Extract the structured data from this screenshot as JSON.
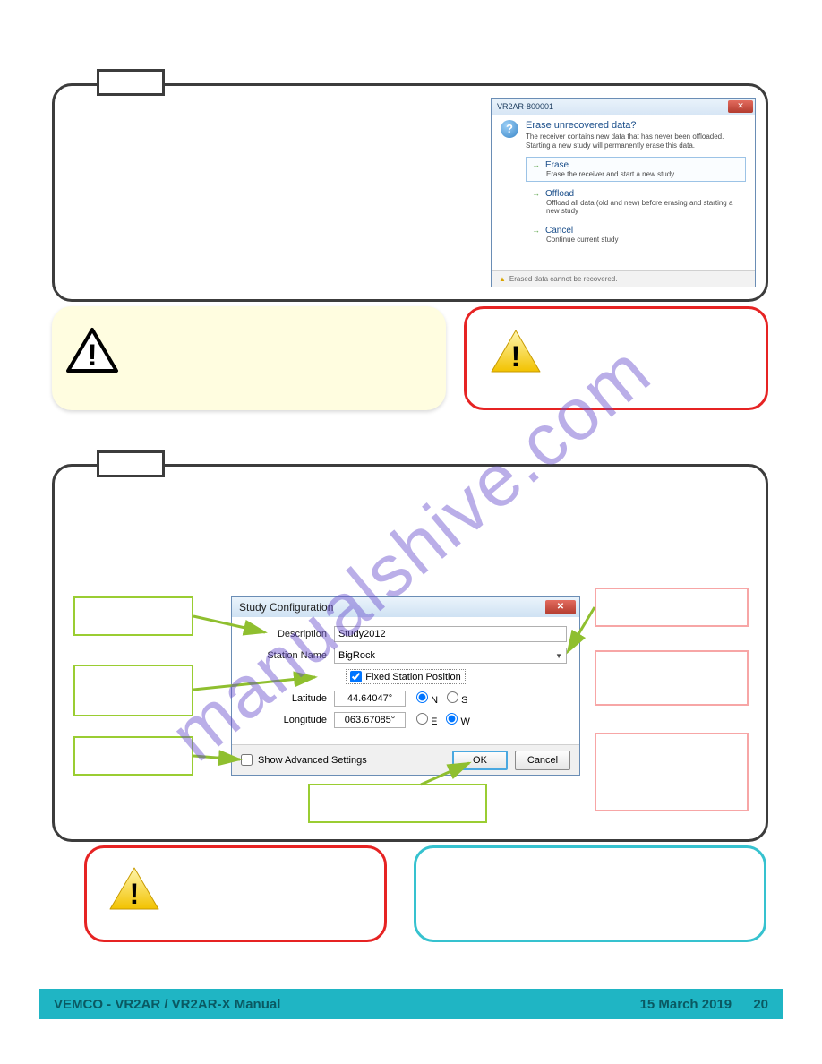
{
  "watermark": "manualshive.com",
  "step_top_label": "",
  "step_bottom_label": "",
  "dlg1": {
    "title": "VR2AR-800001",
    "question_title": "Erase unrecovered data?",
    "question_body": "The receiver contains new data that has never been offloaded. Starting a new study will permanently erase this data.",
    "opt_erase_title": "Erase",
    "opt_erase_desc": "Erase the receiver and start a new study",
    "opt_offload_title": "Offload",
    "opt_offload_desc": "Offload all data (old and new) before erasing and starting a new study",
    "opt_cancel_title": "Cancel",
    "opt_cancel_desc": "Continue current study",
    "footer_warn": "Erased data cannot be recovered."
  },
  "dlg2": {
    "title": "Study Configuration",
    "desc_label": "Description",
    "desc_value": "Study2012",
    "station_label": "Station Name",
    "station_value": "BigRock",
    "fixed_label": "Fixed Station Position",
    "fixed_checked": true,
    "lat_label": "Latitude",
    "lat_value": "44.64047°",
    "lat_n": "N",
    "lat_s": "S",
    "lon_label": "Longitude",
    "lon_value": "063.67085°",
    "lon_e": "E",
    "lon_w": "W",
    "adv_label": "Show Advanced Settings",
    "ok": "OK",
    "cancel": "Cancel"
  },
  "footer": {
    "left": "VEMCO - VR2AR / VR2AR-X Manual",
    "date": "15 March 2019",
    "page": "20"
  }
}
